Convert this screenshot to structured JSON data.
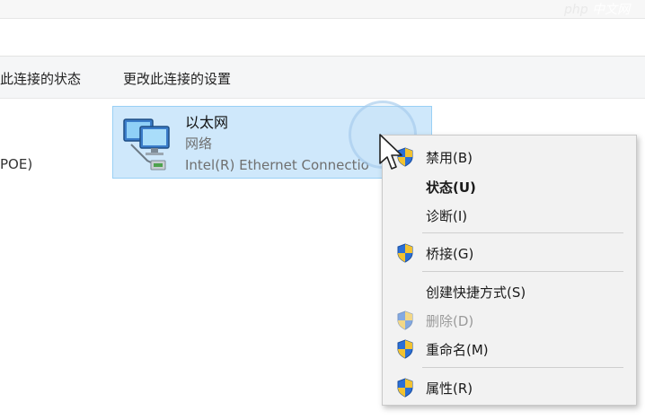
{
  "toolbar": {
    "status_label": "此连接的状态",
    "settings_label": "更改此连接的设置"
  },
  "left_clip_text": "POE)",
  "connection": {
    "name": "以太网",
    "type": "网络",
    "adapter": "Intel(R) Ethernet Connectio"
  },
  "context_menu": {
    "disable": "禁用(B)",
    "status": "状态(U)",
    "diagnose": "诊断(I)",
    "bridge": "桥接(G)",
    "shortcut": "创建快捷方式(S)",
    "delete": "删除(D)",
    "rename": "重命名(M)",
    "properties": "属性(R)"
  },
  "watermark": {
    "text_1": "php",
    "text_2": "中文网"
  },
  "colors": {
    "tile_bg": "#cfe8fb",
    "tile_border": "#99d0f5",
    "menu_bg": "#f2f2f2",
    "shield_blue": "#2a6fd6",
    "shield_yellow": "#f2c230"
  }
}
